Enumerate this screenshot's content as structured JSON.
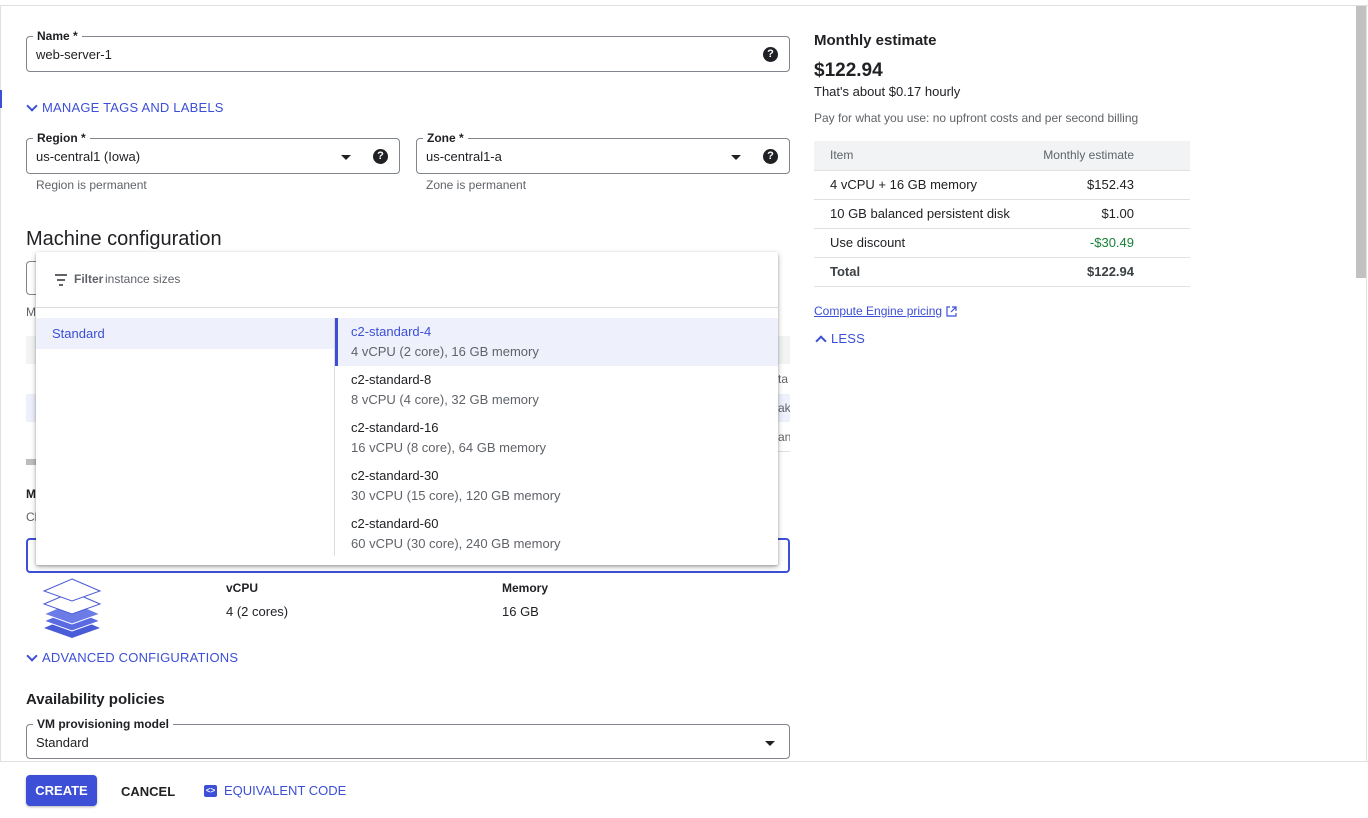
{
  "name_field": {
    "label": "Name *",
    "value": "web-server-1",
    "help": "?"
  },
  "manage_tags": {
    "label": "MANAGE TAGS AND LABELS"
  },
  "region": {
    "label": "Region *",
    "value": "us-central1 (Iowa)",
    "hint": "Region is permanent",
    "help": "?"
  },
  "zone": {
    "label": "Zone *",
    "value": "us-central1-a",
    "hint": "Zone is permanent",
    "help": "?"
  },
  "machine_config": {
    "title": "Machine configuration"
  },
  "background_fragments": {
    "f1": "M",
    "f2": "ta",
    "f3": "ak",
    "f4": "an",
    "f5": "M",
    "f6": "Cl"
  },
  "dropdown": {
    "filter_label": "Filter",
    "filter_placeholder": "instance sizes",
    "category": "Standard",
    "options": [
      {
        "name": "c2-standard-4",
        "desc": "4 vCPU (2 core), 16 GB memory"
      },
      {
        "name": "c2-standard-8",
        "desc": "8 vCPU (4 core), 32 GB memory"
      },
      {
        "name": "c2-standard-16",
        "desc": "16 vCPU (8 core), 64 GB memory"
      },
      {
        "name": "c2-standard-30",
        "desc": "30 vCPU (15 core), 120 GB memory"
      },
      {
        "name": "c2-standard-60",
        "desc": "60 vCPU (30 core), 240 GB memory"
      }
    ]
  },
  "specs": {
    "vcpu_label": "vCPU",
    "vcpu_value": "4 (2 cores)",
    "memory_label": "Memory",
    "memory_value": "16 GB"
  },
  "advanced": {
    "label": "ADVANCED CONFIGURATIONS"
  },
  "availability": {
    "title": "Availability policies",
    "vm_label": "VM provisioning model",
    "vm_value": "Standard"
  },
  "estimate": {
    "title": "Monthly estimate",
    "price": "$122.94",
    "hourly": "That's about $0.17 hourly",
    "note": "Pay for what you use: no upfront costs and per second billing",
    "col_item": "Item",
    "col_estimate": "Monthly estimate",
    "rows": [
      {
        "item": "4 vCPU + 16 GB memory",
        "value": "$152.43"
      },
      {
        "item": "10 GB balanced persistent disk",
        "value": "$1.00"
      },
      {
        "item": "Use discount",
        "value": "-$30.49"
      }
    ],
    "total_label": "Total",
    "total_value": "$122.94",
    "pricing_link": "Compute Engine pricing",
    "less": "LESS",
    "discount_color": "#188038"
  },
  "buttons": {
    "create": "CREATE",
    "cancel": "CANCEL",
    "code": "EQUIVALENT CODE"
  },
  "colors": {
    "accent": "#3c4fd6"
  }
}
